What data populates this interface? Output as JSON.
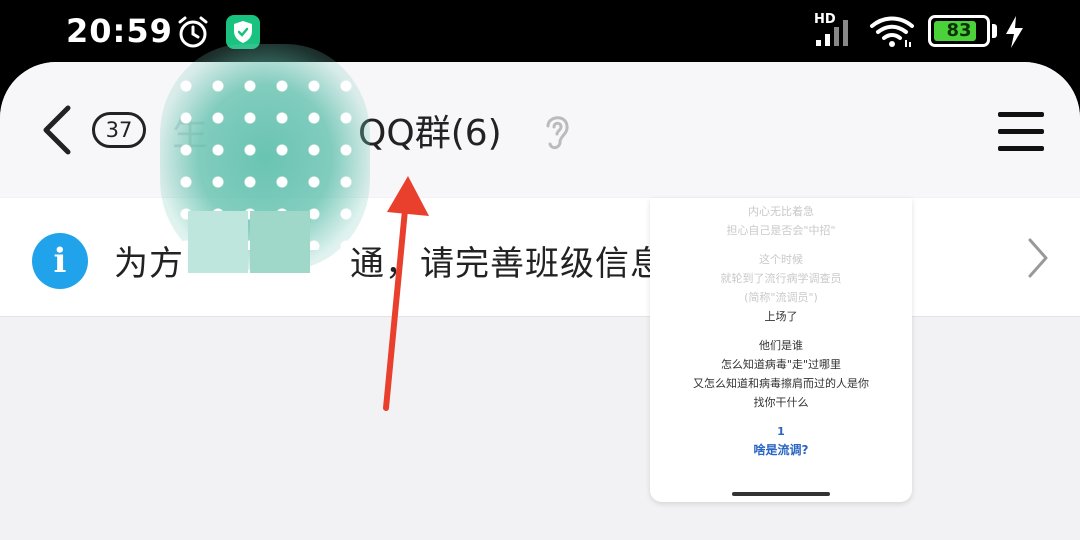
{
  "status_bar": {
    "time": "20:59",
    "network": "HD",
    "battery_percent": "83",
    "battery_level": 0.83,
    "icons": [
      "alarm-icon",
      "security-shield-icon",
      "hd-signal-icon",
      "wifi-icon",
      "battery-icon",
      "charging-icon"
    ]
  },
  "header": {
    "unread_count": "37",
    "title_leading": "生",
    "title_trailing": "QQ群(6)",
    "icons": [
      "back-chevron-icon",
      "earpiece-icon",
      "menu-icon"
    ]
  },
  "notice": {
    "text_start": "为方",
    "text_end": "通，请完善班级信息。",
    "icons": [
      "info-icon",
      "chevron-right-icon"
    ]
  },
  "preview": {
    "lines": [
      "内心无比着急",
      "担心自己是否会\"中招\"",
      "这个时候",
      "就轮到了流行病学调查员",
      "(简称\"流调员\")",
      "上场了",
      "他们是谁",
      "怎么知道病毒\"走\"过哪里",
      "又怎么知道和病毒擦肩而过的人是你",
      "找你干什么",
      "1",
      "啥是流调?"
    ]
  },
  "colors": {
    "accent_blue": "#20a3ea",
    "battery_green": "#4bd23b",
    "arrow_red": "#e8402c",
    "shield_green": "#19c27f"
  }
}
